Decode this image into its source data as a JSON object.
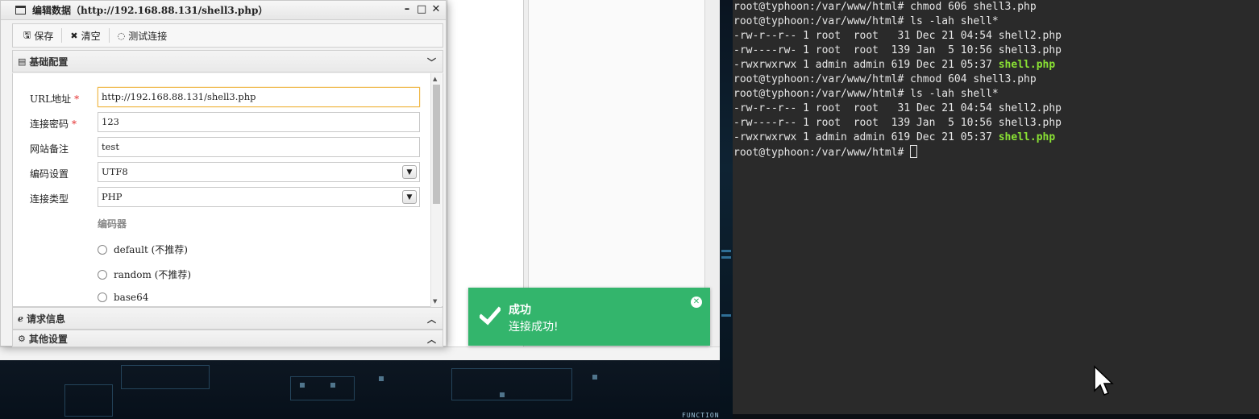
{
  "editor": {
    "title": "编辑数据（http://192.168.88.131/shell3.php）",
    "controls": {
      "minimize": "–",
      "maximize": "□",
      "close": "✕"
    },
    "toolbar": {
      "save": "保存",
      "clear": "清空",
      "test": "测试连接"
    },
    "sections": {
      "basic": "基础配置",
      "request": "请求信息",
      "other": "其他设置"
    },
    "form": {
      "url_label": "URL地址",
      "url_value": "http://192.168.88.131/shell3.php",
      "password_label": "连接密码",
      "password_value": "123",
      "note_label": "网站备注",
      "note_value": "test",
      "encoding_label": "编码设置",
      "encoding_value": "UTF8",
      "type_label": "连接类型",
      "type_value": "PHP",
      "required_mark": "*",
      "encoder_heading": "编码器",
      "encoders": [
        "default (不推荐)",
        "random (不推荐)",
        "base64"
      ]
    }
  },
  "toast": {
    "title": "成功",
    "message": "连接成功!",
    "color": "#33b56c"
  },
  "terminal": {
    "lines": [
      {
        "text": "root@typhoon:/var/www/html# chmod 606 shell3.php",
        "highlight": ""
      },
      {
        "text": "root@typhoon:/var/www/html# ls -lah shell*",
        "highlight": ""
      },
      {
        "text": "-rw-r--r-- 1 root  root   31 Dec 21 04:54 shell2.php",
        "highlight": ""
      },
      {
        "text": "-rw----rw- 1 root  root  139 Jan  5 10:56 shell3.php",
        "highlight": ""
      },
      {
        "text": "-rwxrwxrwx 1 admin admin 619 Dec 21 05:37 ",
        "highlight": "shell.php"
      },
      {
        "text": "root@typhoon:/var/www/html# chmod 604 shell3.php",
        "highlight": ""
      },
      {
        "text": "root@typhoon:/var/www/html# ls -lah shell*",
        "highlight": ""
      },
      {
        "text": "-rw-r--r-- 1 root  root   31 Dec 21 04:54 shell2.php",
        "highlight": ""
      },
      {
        "text": "-rw----r-- 1 root  root  139 Jan  5 10:56 shell3.php",
        "highlight": ""
      },
      {
        "text": "-rwxrwxrwx 1 admin admin 619 Dec 21 05:37 ",
        "highlight": "shell.php"
      },
      {
        "text": "root@typhoon:/var/www/html# ",
        "highlight": ""
      }
    ],
    "highlight_color": "#8ae234"
  },
  "desktop": {
    "label": "FUNCTIONS"
  }
}
